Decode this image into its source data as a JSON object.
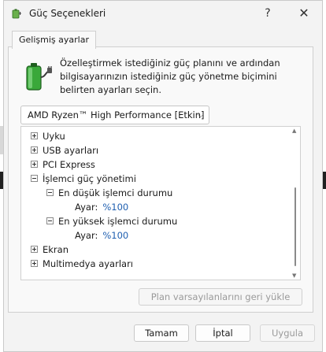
{
  "window": {
    "title": "Güç Seçenekleri",
    "help_label": "?",
    "close_label": "✕"
  },
  "tabs": [
    {
      "label": "Gelişmiş ayarlar"
    }
  ],
  "description": "Özelleştirmek istediğiniz güç planını ve ardından bilgisayarınızın istediğiniz güç yönetme biçimini belirten ayarları seçin.",
  "plan_select": {
    "selected": "AMD Ryzen™ High Performance [Etkin]"
  },
  "tree": {
    "items": [
      {
        "label": "Uyku"
      },
      {
        "label": "USB ayarları"
      },
      {
        "label": "PCI Express"
      },
      {
        "label": "İşlemci güç yönetimi"
      },
      {
        "label": "En düşük işlemci durumu"
      },
      {
        "label": "Ayar:",
        "value": "%100"
      },
      {
        "label": "En yüksek işlemci durumu"
      },
      {
        "label": "Ayar:",
        "value": "%100"
      },
      {
        "label": "Ekran"
      },
      {
        "label": "Multimedya ayarları"
      }
    ]
  },
  "buttons": {
    "restore": "Plan varsayılanlarını geri yükle",
    "ok": "Tamam",
    "cancel": "İptal",
    "apply": "Uygula"
  },
  "icons": {
    "app": "power-options-icon",
    "battery": "battery-plug-icon"
  },
  "colors": {
    "value_text": "#1f5fb0",
    "battery_green": "#3aa83a"
  }
}
